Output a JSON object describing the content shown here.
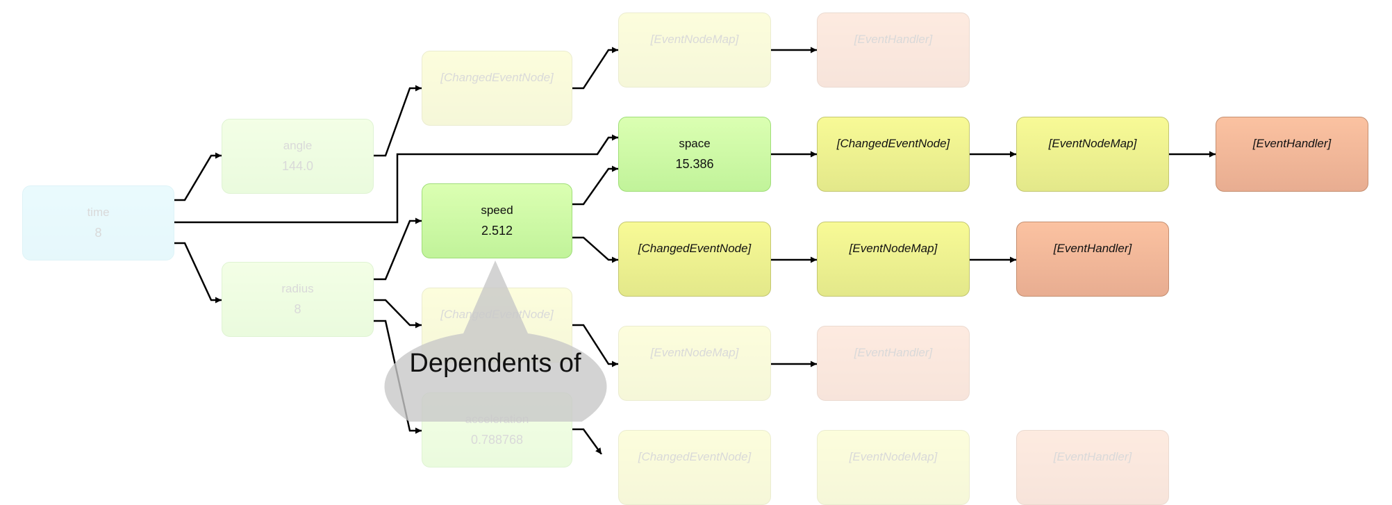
{
  "nodes": {
    "time": {
      "label": "time",
      "value": "8"
    },
    "angle": {
      "label": "angle",
      "value": "144.0"
    },
    "radius": {
      "label": "radius",
      "value": "8"
    },
    "speed": {
      "label": "speed",
      "value": "2.512"
    },
    "acceleration": {
      "label": "acceleration",
      "value": "0.788768"
    },
    "space": {
      "label": "space",
      "value": "15.386"
    },
    "angle_changed": {
      "label": "[ChangedEventNode]"
    },
    "angle_map": {
      "label": "[EventNodeMap]"
    },
    "angle_handler": {
      "label": "[EventHandler]"
    },
    "space_changed": {
      "label": "[ChangedEventNode]"
    },
    "space_map": {
      "label": "[EventNodeMap]"
    },
    "space_handler": {
      "label": "[EventHandler]"
    },
    "speed_changed": {
      "label": "[ChangedEventNode]"
    },
    "speed_map": {
      "label": "[EventNodeMap]"
    },
    "speed_handler": {
      "label": "[EventHandler]"
    },
    "radius_changed": {
      "label": "[ChangedEventNode]"
    },
    "radius_map": {
      "label": "[EventNodeMap]"
    },
    "radius_handler": {
      "label": "[EventHandler]"
    },
    "accel_changed": {
      "label": "[ChangedEventNode]"
    },
    "accel_map": {
      "label": "[EventNodeMap]"
    },
    "accel_handler": {
      "label": "[EventHandler]"
    }
  },
  "callout": {
    "text": "Dependents of"
  },
  "colors": {
    "input": "#b3eaf5",
    "cell": "#c1f39a",
    "event": "#e3e88a",
    "handler": "#e8ad91",
    "edge": "#000000",
    "callout": "#c8c8c8"
  }
}
